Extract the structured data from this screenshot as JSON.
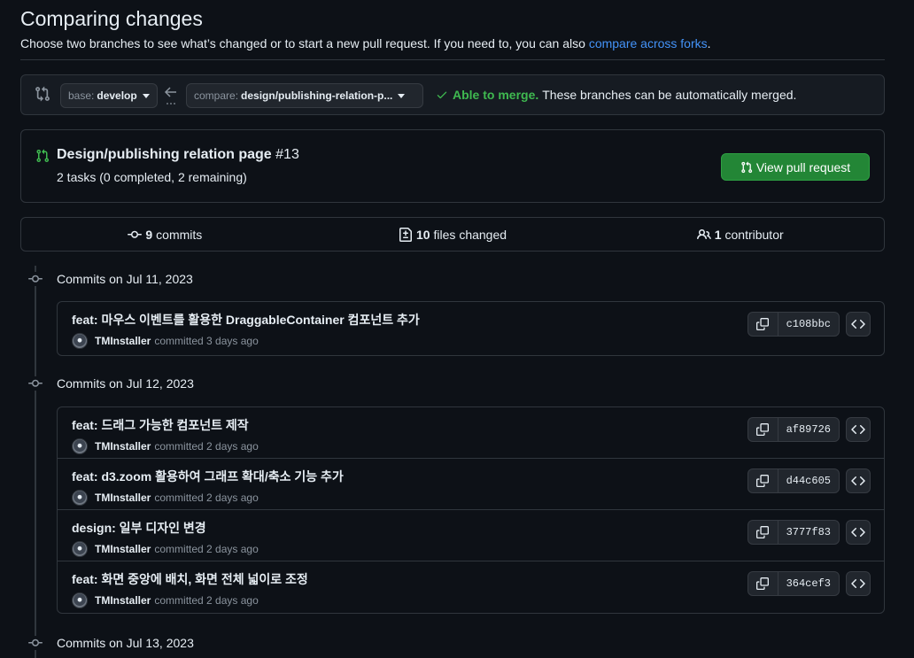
{
  "header": {
    "title": "Comparing changes",
    "desc_prefix": "Choose two branches to see what’s changed or to start a new pull request. If you need to, you can also ",
    "desc_link": "compare across forks",
    "desc_suffix": "."
  },
  "range": {
    "base_label": "base:",
    "base_value": "develop",
    "compare_label": "compare:",
    "compare_value": "design/publishing-relation-p...",
    "merge_ok": "Able to merge.",
    "merge_text": "These branches can be automatically merged."
  },
  "pr": {
    "title": "Design/publishing relation page",
    "number": "#13",
    "tasks": "2 tasks (0 completed, 2 remaining)",
    "button": "View pull request"
  },
  "stats": {
    "commits_count": "9",
    "commits_label": "commits",
    "files_count": "10",
    "files_label": "files changed",
    "contrib_count": "1",
    "contrib_label": "contributor"
  },
  "days": [
    {
      "label": "Commits on Jul 11, 2023",
      "commits": [
        {
          "message": "feat: 마우스 이벤트를 활용한 DraggableContainer 컴포넌트 추가",
          "author": "TMInstaller",
          "time": "committed 3 days ago",
          "sha": "c108bbc"
        }
      ]
    },
    {
      "label": "Commits on Jul 12, 2023",
      "commits": [
        {
          "message": "feat: 드래그 가능한 컴포넌트 제작",
          "author": "TMInstaller",
          "time": "committed 2 days ago",
          "sha": "af89726"
        },
        {
          "message": "feat: d3.zoom 활용하여 그래프 확대/축소 기능 추가",
          "author": "TMInstaller",
          "time": "committed 2 days ago",
          "sha": "d44c605"
        },
        {
          "message": "design: 일부 디자인 변경",
          "author": "TMInstaller",
          "time": "committed 2 days ago",
          "sha": "3777f83"
        },
        {
          "message": "feat: 화면 중앙에 배치, 화면 전체 넓이로 조정",
          "author": "TMInstaller",
          "time": "committed 2 days ago",
          "sha": "364cef3"
        }
      ]
    },
    {
      "label": "Commits on Jul 13, 2023",
      "commits": []
    }
  ],
  "colors": {
    "accent_green": "#3fb950",
    "button_green": "#238636",
    "link_blue": "#4493f8"
  },
  "icons": {
    "compare": "git-compare-icon",
    "pull_request": "git-pull-request-icon",
    "commit": "git-commit-icon",
    "files": "file-diff-icon",
    "people": "people-icon",
    "copy": "copy-icon",
    "browse": "code-icon",
    "check": "check-icon"
  }
}
